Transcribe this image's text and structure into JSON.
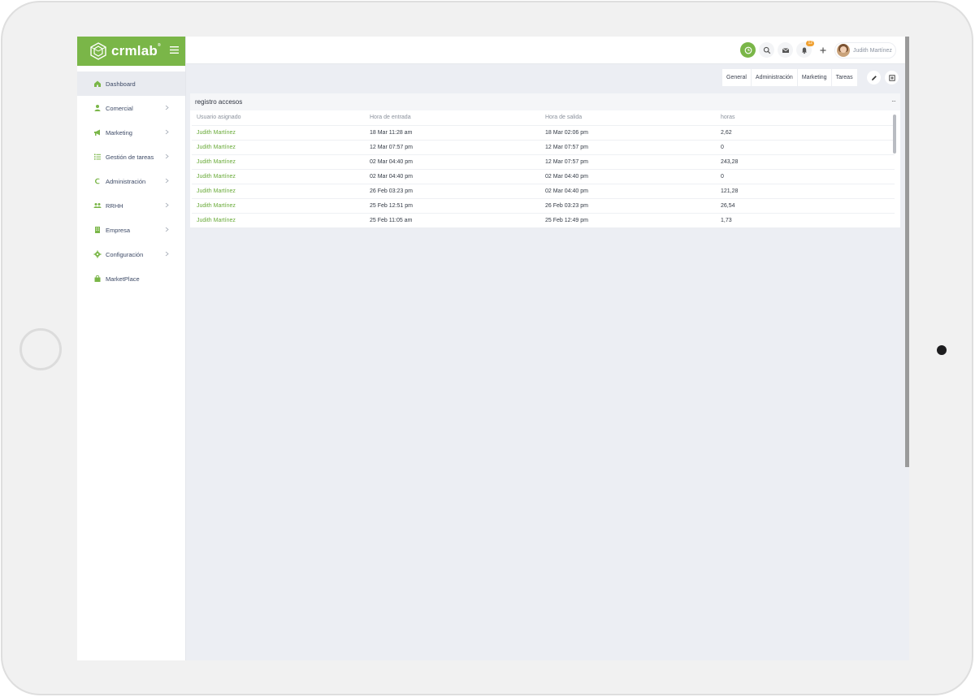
{
  "brand": {
    "name": "crmlab",
    "reg": "®",
    "accent": "#7ab648"
  },
  "sidebar": {
    "items": [
      {
        "label": "Dashboard",
        "icon": "home-icon",
        "active": true,
        "has_submenu": false
      },
      {
        "label": "Comercial",
        "icon": "user-icon",
        "has_submenu": true
      },
      {
        "label": "Marketing",
        "icon": "megaphone-icon",
        "has_submenu": true
      },
      {
        "label": "Gestión de tareas",
        "icon": "list-icon",
        "has_submenu": true
      },
      {
        "label": "Administración",
        "icon": "euro-icon",
        "has_submenu": true
      },
      {
        "label": "RRHH",
        "icon": "users-icon",
        "has_submenu": true
      },
      {
        "label": "Empresa",
        "icon": "building-icon",
        "has_submenu": true
      },
      {
        "label": "Configuración",
        "icon": "gear-icon",
        "has_submenu": true
      },
      {
        "label": "MarketPlace",
        "icon": "bag-icon",
        "has_submenu": false
      }
    ]
  },
  "topbar": {
    "notifications_count": "12",
    "user_name": "Judith Martínez"
  },
  "tabs": [
    "General",
    "Administración",
    "Marketing",
    "Tareas"
  ],
  "widget": {
    "title": "registro accesos",
    "menu": "···",
    "columns": [
      "Usuario asignado",
      "Hora de entrada",
      "Hora de salida",
      "horas"
    ],
    "rows": [
      [
        "Judith Martínez",
        "18 Mar 11:28 am",
        "18 Mar 02:06 pm",
        "2,62"
      ],
      [
        "Judith Martínez",
        "12 Mar 07:57 pm",
        "12 Mar 07:57 pm",
        "0"
      ],
      [
        "Judith Martínez",
        "02 Mar 04:40 pm",
        "12 Mar 07:57 pm",
        "243,28"
      ],
      [
        "Judith Martínez",
        "02 Mar 04:40 pm",
        "02 Mar 04:40 pm",
        "0"
      ],
      [
        "Judith Martínez",
        "26 Feb 03:23 pm",
        "02 Mar 04:40 pm",
        "121,28"
      ],
      [
        "Judith Martínez",
        "25 Feb 12:51 pm",
        "26 Feb 03:23 pm",
        "26,54"
      ],
      [
        "Judith Martínez",
        "25 Feb 11:05 am",
        "25 Feb 12:49 pm",
        "1,73"
      ]
    ]
  }
}
